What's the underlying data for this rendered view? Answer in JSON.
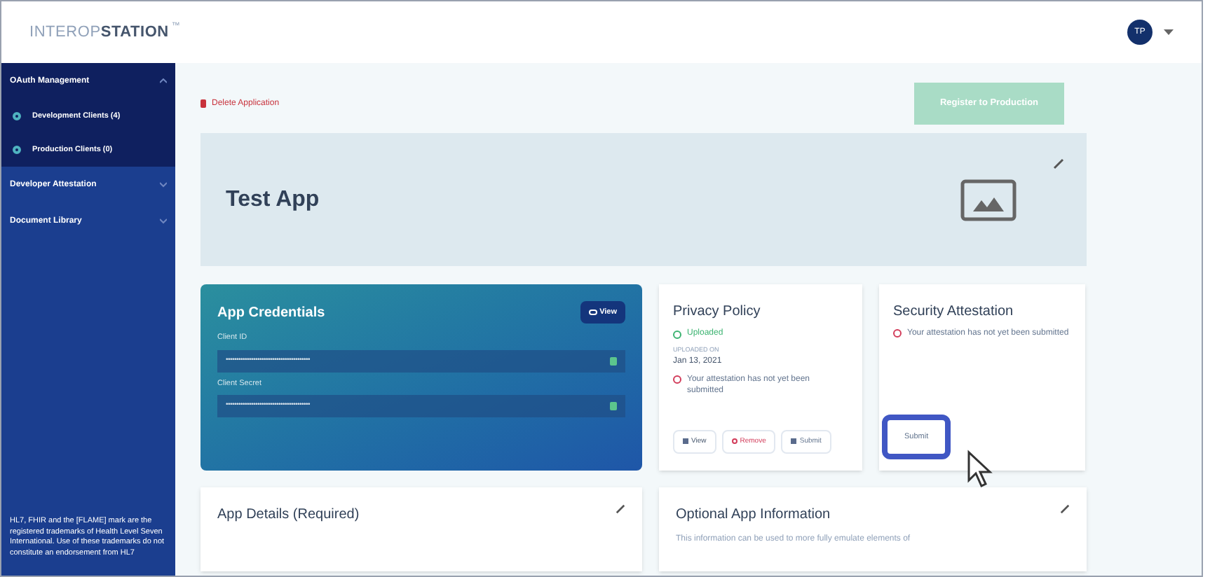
{
  "header": {
    "logo_light": "INTEROP",
    "logo_bold": "STATION",
    "logo_mark": "™",
    "avatar": "TP"
  },
  "sidebar": {
    "items": [
      {
        "label": "OAuth Management",
        "expanded": true,
        "children": [
          {
            "label": "Development Clients (4)"
          },
          {
            "label": "Production Clients (0)"
          }
        ]
      },
      {
        "label": "Developer Attestation",
        "expanded": false
      },
      {
        "label": "Document Library",
        "expanded": false
      }
    ],
    "footer": "HL7, FHIR and the [FLAME] mark are the registered trademarks of Health Level Seven International. Use of these trademarks do not constitute an endorsement from HL7"
  },
  "actions": {
    "delete": "Delete Application",
    "register": "Register to Production",
    "register_disabled": true
  },
  "banner": {
    "title": "Test App"
  },
  "credentials": {
    "title": "App Credentials",
    "view": "View",
    "fields": [
      {
        "label": "Client ID",
        "value": "••••••••••••••••••••••••••••••••••••••••"
      },
      {
        "label": "Client Secret",
        "value": "••••••••••••••••••••••••••••••••••••••••"
      }
    ]
  },
  "privacy": {
    "title": "Privacy Policy",
    "status": "Uploaded",
    "uploaded_label": "UPLOADED ON",
    "date": "Jan 13, 2021",
    "warning": "Your attestation has not yet been submitted",
    "buttons": [
      {
        "kind": "view",
        "label": "View"
      },
      {
        "kind": "remove",
        "label": "Remove"
      },
      {
        "kind": "submit",
        "label": "Submit"
      }
    ]
  },
  "security": {
    "title": "Security Attestation",
    "warning": "Your attestation has not yet been submitted",
    "button": {
      "label": "Submit",
      "highlighted": true
    }
  },
  "details": {
    "title": "App Details (Required)"
  },
  "optional": {
    "title": "Optional App Information",
    "text": "This information can be used to more fully emulate elements of"
  }
}
